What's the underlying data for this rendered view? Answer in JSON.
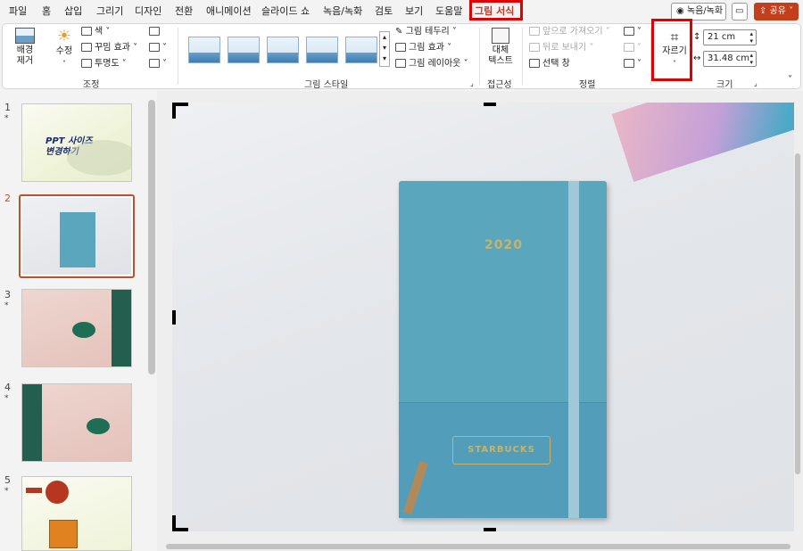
{
  "tabs": [
    "파일",
    "홈",
    "삽입",
    "그리기",
    "디자인",
    "전환",
    "애니메이션",
    "슬라이드 쇼",
    "녹음/녹화",
    "검토",
    "보기",
    "도움말",
    "그림 서식"
  ],
  "active_tab": "그림 서식",
  "record_button": "녹음/녹화",
  "share_button": "공유",
  "ribbon": {
    "remove_bg": "배경\n제거",
    "corrections": "수정",
    "color": "색",
    "artistic_effects": "꾸밈 효과",
    "transparency": "투명도",
    "adjust_group": "조정",
    "picture_border": "그림 테두리",
    "picture_effects": "그림 효과",
    "picture_layout": "그림 레이아웃",
    "styles_group": "그림 스타일",
    "alt_text": "대체\n텍스트",
    "accessibility_group": "접근성",
    "bring_forward": "앞으로 가져오기",
    "send_backward": "뒤로 보내기",
    "selection_pane": "선택 창",
    "arrange_group": "정렬",
    "crop": "자르기",
    "height": "21 cm",
    "width": "31.48 cm",
    "size_group": "크기"
  },
  "slides": [
    {
      "num": "1",
      "title": "PPT 사이즈\n변경하기"
    },
    {
      "num": "2"
    },
    {
      "num": "3"
    },
    {
      "num": "4"
    },
    {
      "num": "5"
    }
  ],
  "notebook": {
    "year": "2020",
    "brand": "STARBUCKS"
  },
  "colors": {
    "accent": "#c0392b",
    "highlight": "#e00000",
    "share": "#c43e1c"
  }
}
